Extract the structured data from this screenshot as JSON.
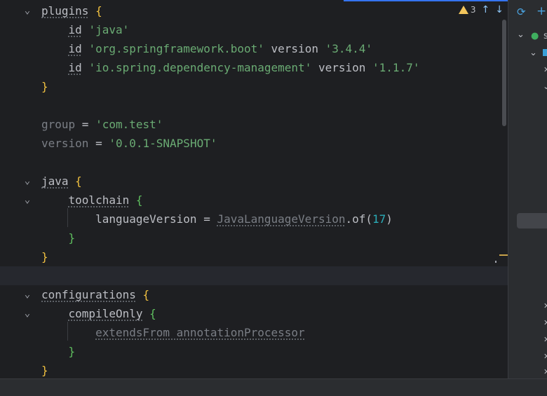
{
  "editor": {
    "inspection": {
      "warning_count": "3"
    },
    "lines": [
      {
        "fold": "⌄",
        "tokens": [
          {
            "t": "plugins",
            "c": "kw"
          },
          {
            "t": " "
          },
          {
            "t": "{",
            "c": "brace"
          }
        ]
      },
      {
        "tokens": [
          {
            "t": "    "
          },
          {
            "t": "id",
            "c": "kw"
          },
          {
            "t": " "
          },
          {
            "t": "'java'",
            "c": "str"
          }
        ]
      },
      {
        "tokens": [
          {
            "t": "    "
          },
          {
            "t": "id",
            "c": "kw"
          },
          {
            "t": " "
          },
          {
            "t": "'org.springframework.boot'",
            "c": "str"
          },
          {
            "t": " version "
          },
          {
            "t": "'3.4.4'",
            "c": "str"
          }
        ]
      },
      {
        "tokens": [
          {
            "t": "    "
          },
          {
            "t": "id",
            "c": "kw"
          },
          {
            "t": " "
          },
          {
            "t": "'io.spring.dependency-management'",
            "c": "str"
          },
          {
            "t": " version "
          },
          {
            "t": "'1.1.7'",
            "c": "str"
          }
        ]
      },
      {
        "tokens": [
          {
            "t": "}",
            "c": "brace"
          }
        ]
      },
      {
        "tokens": []
      },
      {
        "tokens": [
          {
            "t": "group",
            "c": "dim"
          },
          {
            "t": " = "
          },
          {
            "t": "'com.test'",
            "c": "str"
          }
        ]
      },
      {
        "tokens": [
          {
            "t": "version",
            "c": "dim"
          },
          {
            "t": " = "
          },
          {
            "t": "'0.0.1-SNAPSHOT'",
            "c": "str"
          }
        ]
      },
      {
        "tokens": []
      },
      {
        "fold": "⌄",
        "tokens": [
          {
            "t": "java",
            "c": "kw"
          },
          {
            "t": " "
          },
          {
            "t": "{",
            "c": "brace"
          }
        ]
      },
      {
        "fold": "⌄",
        "tokens": [
          {
            "t": "    "
          },
          {
            "t": "toolchain",
            "c": "kw"
          },
          {
            "t": " "
          },
          {
            "t": "{",
            "c": "brace2"
          }
        ]
      },
      {
        "tokens": [
          {
            "t": "        languageVersion = "
          },
          {
            "t": "JavaLanguageVersion",
            "c": "deco"
          },
          {
            "t": ".of("
          },
          {
            "t": "17",
            "c": "num"
          },
          {
            "t": ")"
          }
        ]
      },
      {
        "tokens": [
          {
            "t": "    "
          },
          {
            "t": "}",
            "c": "brace2"
          }
        ]
      },
      {
        "tokens": [
          {
            "t": "}",
            "c": "brace"
          }
        ]
      },
      {
        "tokens": [],
        "current": true
      },
      {
        "fold": "⌄",
        "tokens": [
          {
            "t": "configurations",
            "c": "kw"
          },
          {
            "t": " "
          },
          {
            "t": "{",
            "c": "brace"
          }
        ]
      },
      {
        "fold": "⌄",
        "tokens": [
          {
            "t": "    "
          },
          {
            "t": "compileOnly",
            "c": "kw"
          },
          {
            "t": " "
          },
          {
            "t": "{",
            "c": "brace2"
          }
        ]
      },
      {
        "tokens": [
          {
            "t": "        "
          },
          {
            "t": "extendsFrom annotationProcessor",
            "c": "deco"
          }
        ]
      },
      {
        "tokens": [
          {
            "t": "    "
          },
          {
            "t": "}",
            "c": "brace2"
          }
        ]
      },
      {
        "tokens": [
          {
            "t": "}",
            "c": "brace"
          }
        ]
      }
    ]
  },
  "side_panel": {
    "icons": [
      "sync-icon",
      "add-icon",
      "chevron-down-icon",
      "gradle-icon",
      "module-icon"
    ]
  }
}
